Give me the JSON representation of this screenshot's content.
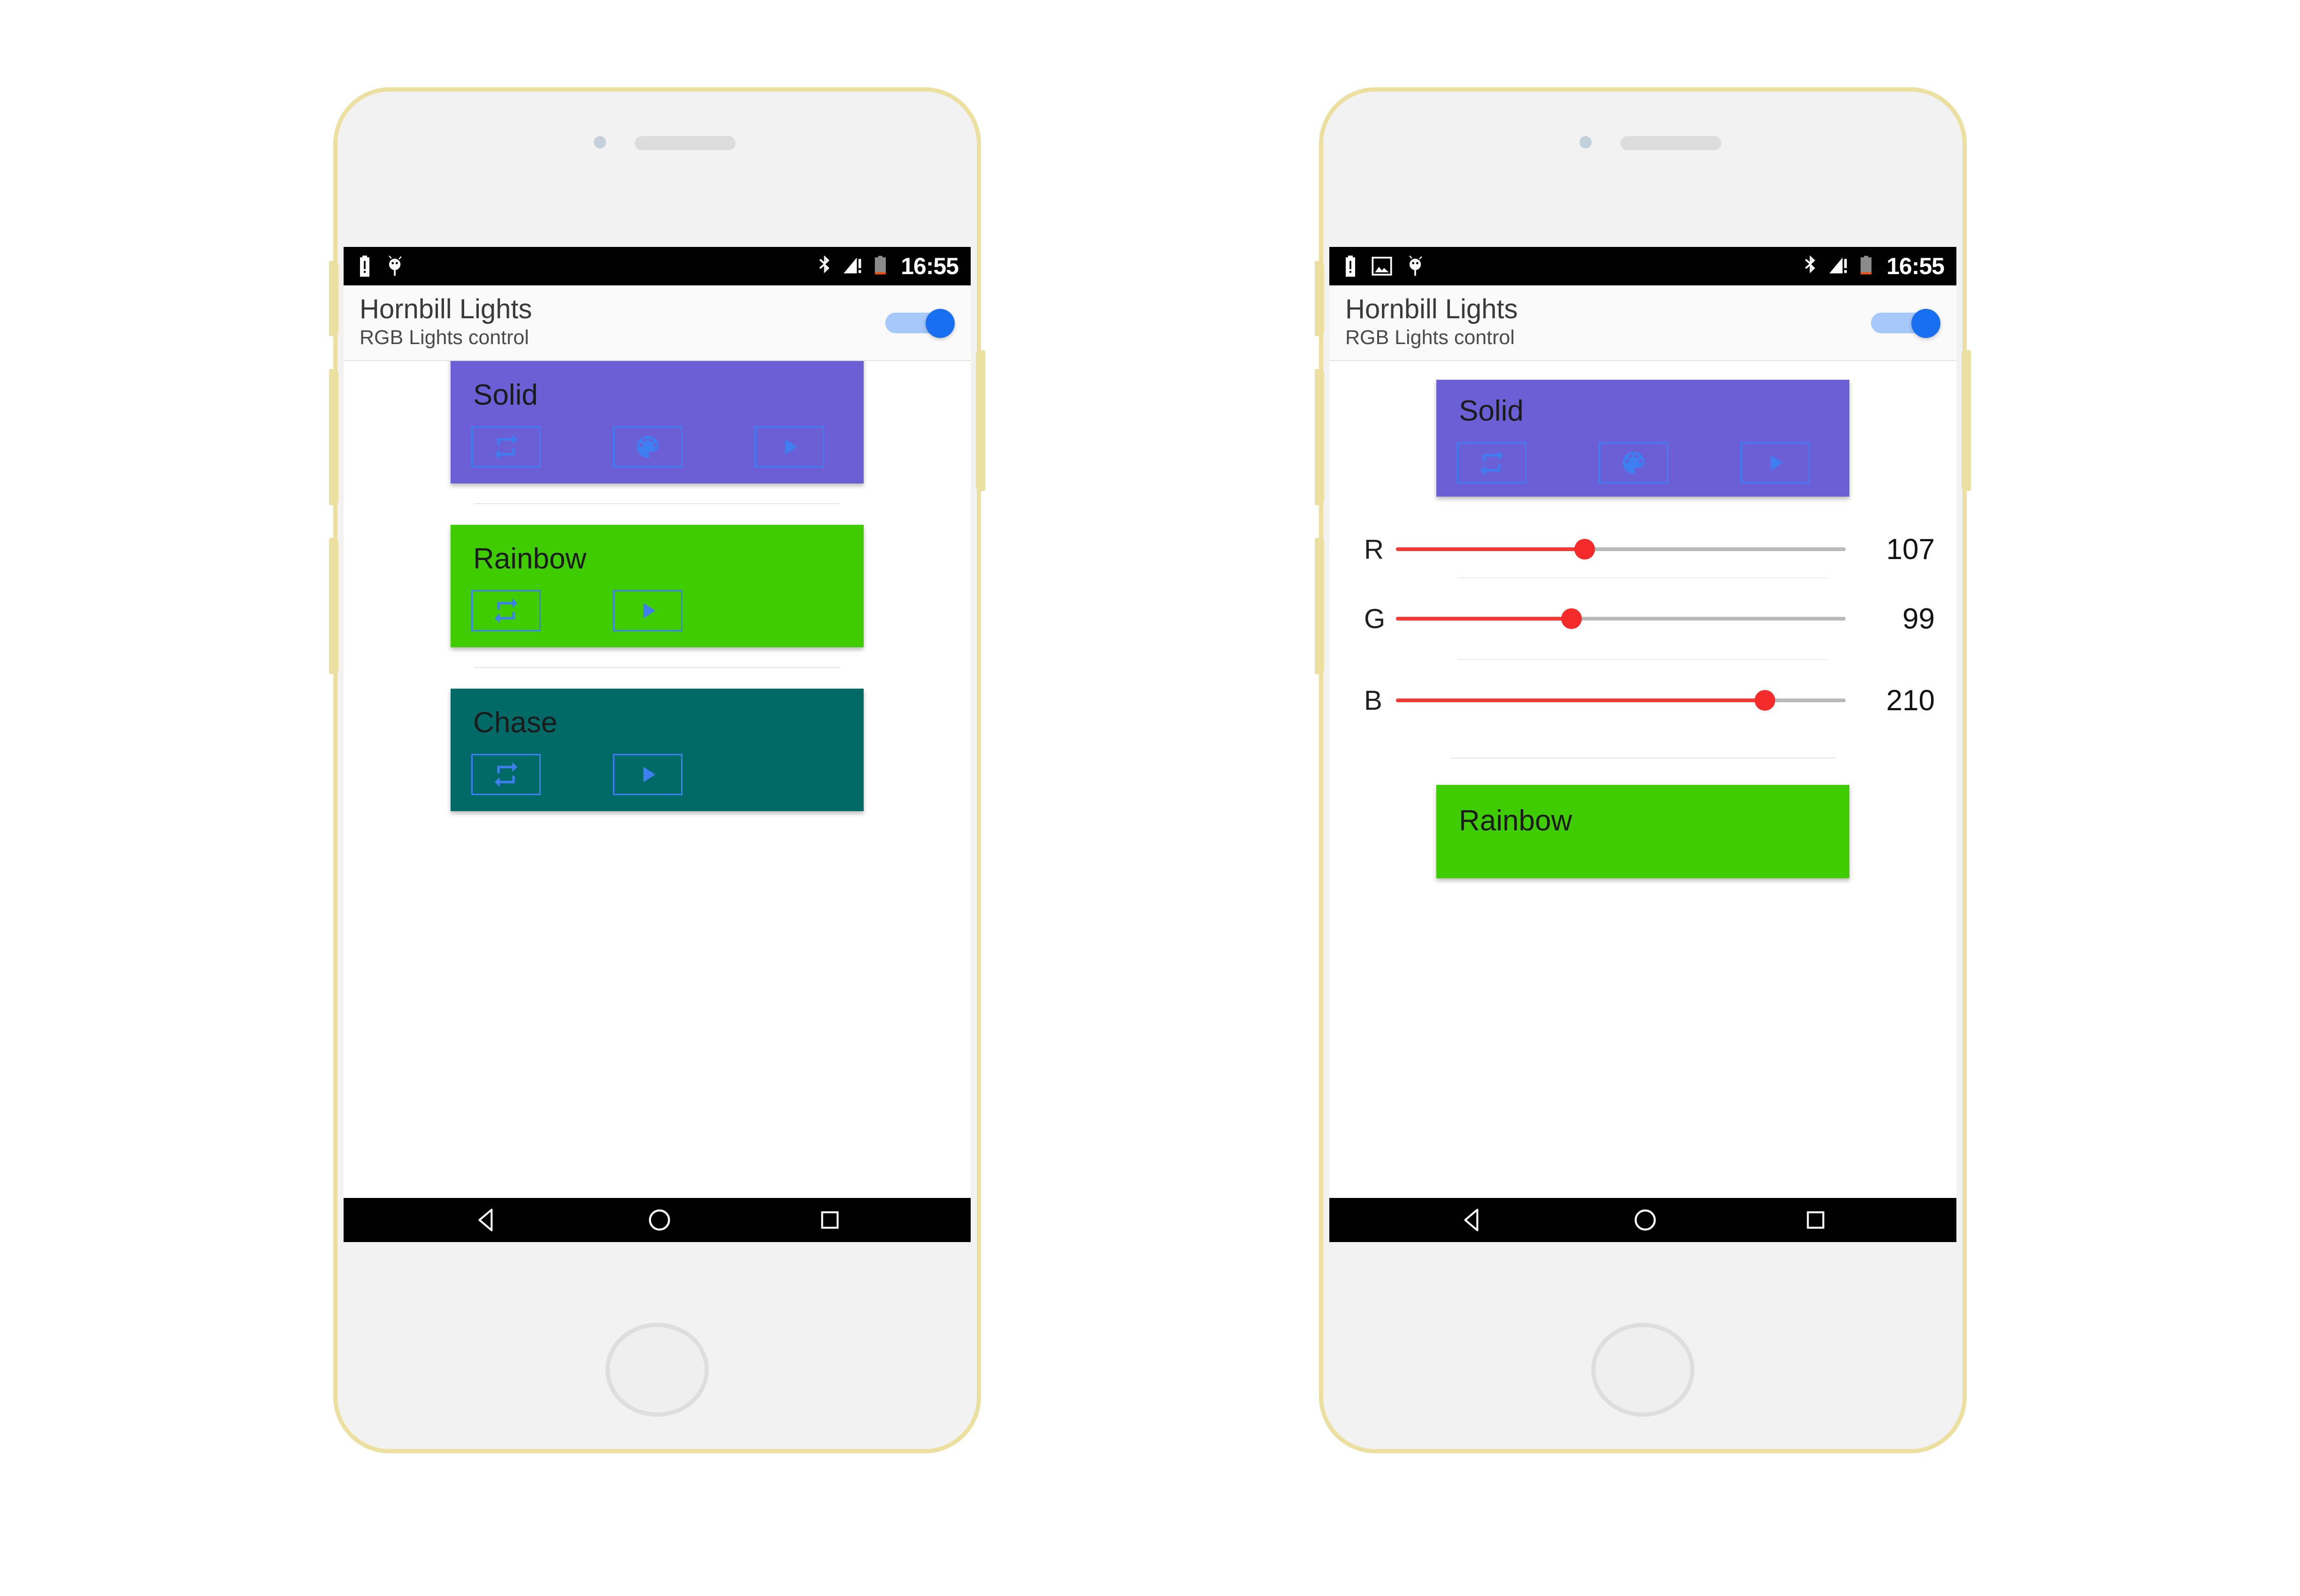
{
  "app": {
    "title": "Hornbill Lights",
    "subtitle": "RGB Lights control",
    "power_toggle_state": "on",
    "accent_blue": "#1a6ef0",
    "button_outline_blue": "#3d7ff0"
  },
  "status_bar": {
    "time": "16:55",
    "left_icons_left_phone": [
      "battery-alert-icon",
      "usb-debugging-icon"
    ],
    "left_icons_right_phone": [
      "battery-alert-icon",
      "screenshot-image-icon",
      "usb-debugging-icon"
    ],
    "right_icons": [
      "bluetooth-icon",
      "signal-no-service-icon",
      "battery-low-icon"
    ],
    "background": "#000000"
  },
  "nav_bar": {
    "back_label": "Back",
    "home_label": "Home",
    "recents_label": "Recents"
  },
  "effects": [
    {
      "name": "Solid",
      "color": "#6b5fd6",
      "buttons": [
        {
          "icon": "repeat-icon",
          "label": "Loop"
        },
        {
          "icon": "palette-icon",
          "label": "Color"
        },
        {
          "icon": "play-icon",
          "label": "Play"
        }
      ]
    },
    {
      "name": "Rainbow",
      "color": "#3fcc00",
      "buttons": [
        {
          "icon": "repeat-icon",
          "label": "Loop"
        },
        {
          "icon": "play-icon",
          "label": "Play"
        }
      ]
    },
    {
      "name": "Chase",
      "color": "#026a66",
      "buttons": [
        {
          "icon": "repeat-icon",
          "label": "Loop"
        },
        {
          "icon": "play-icon",
          "label": "Play"
        }
      ]
    }
  ],
  "rgb_sliders": {
    "track_color": "#b9b9b9",
    "fill_color": "#ef3b36",
    "thumb_color": "#f32b2b",
    "max": 255,
    "channels": [
      {
        "label": "R",
        "value": "107",
        "percent": 42
      },
      {
        "label": "G",
        "value": "99",
        "percent": 39
      },
      {
        "label": "B",
        "value": "210",
        "percent": 82
      }
    ]
  },
  "left_phone": {
    "view": "effects-list",
    "visible_cards": [
      "Solid",
      "Rainbow",
      "Chase"
    ]
  },
  "right_phone": {
    "view": "solid-expanded-with-rgb-sliders",
    "visible_cards": [
      "Solid",
      "Rainbow"
    ]
  },
  "device": {
    "frame_color": "#ece0a0",
    "body_color": "#f2f2f2"
  }
}
